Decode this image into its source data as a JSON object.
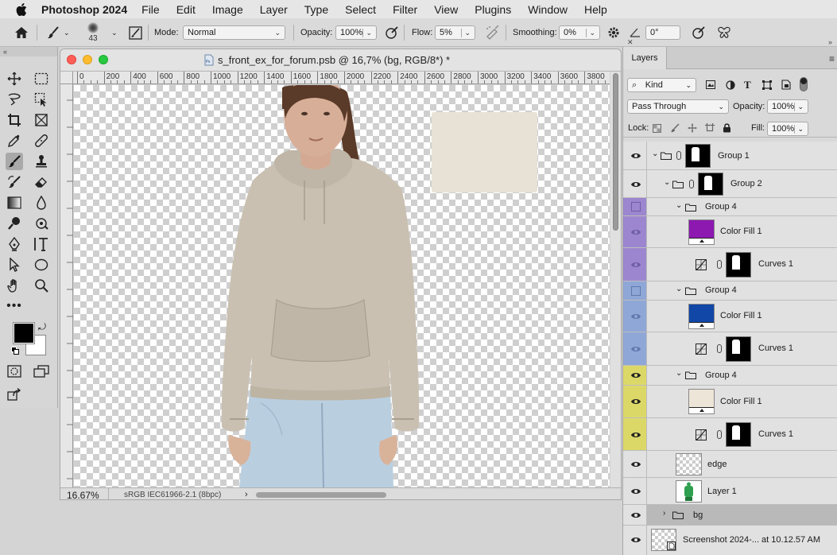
{
  "menubar": {
    "app": "Photoshop 2024",
    "items": [
      "File",
      "Edit",
      "Image",
      "Layer",
      "Type",
      "Select",
      "Filter",
      "View",
      "Plugins",
      "Window",
      "Help"
    ]
  },
  "options": {
    "brush_size": "43",
    "mode_label": "Mode:",
    "mode_value": "Normal",
    "opacity_label": "Opacity:",
    "opacity_value": "100%",
    "flow_label": "Flow:",
    "flow_value": "5%",
    "smoothing_label": "Smoothing:",
    "smoothing_value": "0%",
    "angle_value": "0°"
  },
  "document": {
    "title": "s_front_ex_for_forum.psb @ 16,7% (bg, RGB/8*) *",
    "zoom": "16.67%",
    "profile": "sRGB IEC61966-2.1 (8bpc)",
    "ruler_labels": [
      "0",
      "200",
      "400",
      "600",
      "800",
      "1000",
      "1200",
      "1400",
      "1600",
      "1800",
      "2000",
      "2200",
      "2400",
      "2600",
      "2800",
      "3000",
      "3200",
      "3400",
      "3600",
      "3800"
    ]
  },
  "colors": {
    "hoodie": "#c9c0b2",
    "swatch": "#e8e1d5",
    "purple": "#8d19b1",
    "blue": "#1147a6",
    "beige": "#ede5d7",
    "label_purple": "#9c86cf",
    "label_blue": "#8fa7d6",
    "label_yellow": "#dcd868",
    "traffic_red": "#ff5f57",
    "traffic_yellow": "#febc2e",
    "traffic_green": "#28c840"
  },
  "layers_panel": {
    "tab": "Layers",
    "filter_kind": "Kind",
    "blend_mode": "Pass Through",
    "opacity_label": "Opacity:",
    "opacity_value": "100%",
    "lock_label": "Lock:",
    "fill_label": "Fill:",
    "fill_value": "100%",
    "layers": [
      {
        "name": "Group 1",
        "kind": "group"
      },
      {
        "name": "Group 2",
        "kind": "group"
      },
      {
        "name": "Group 4",
        "kind": "group"
      },
      {
        "name": "Color Fill 1",
        "kind": "fill"
      },
      {
        "name": "Curves 1",
        "kind": "curves"
      },
      {
        "name": "Group 4",
        "kind": "group"
      },
      {
        "name": "Color Fill 1",
        "kind": "fill"
      },
      {
        "name": "Curves 1",
        "kind": "curves"
      },
      {
        "name": "Group 4",
        "kind": "group"
      },
      {
        "name": "Color Fill 1",
        "kind": "fill"
      },
      {
        "name": "Curves 1",
        "kind": "curves"
      },
      {
        "name": "edge",
        "kind": "pixel"
      },
      {
        "name": "Layer 1",
        "kind": "pixel"
      },
      {
        "name": "bg",
        "kind": "group"
      },
      {
        "name": "Screenshot 2024-... at 10.12.57 AM",
        "kind": "smart"
      }
    ]
  }
}
